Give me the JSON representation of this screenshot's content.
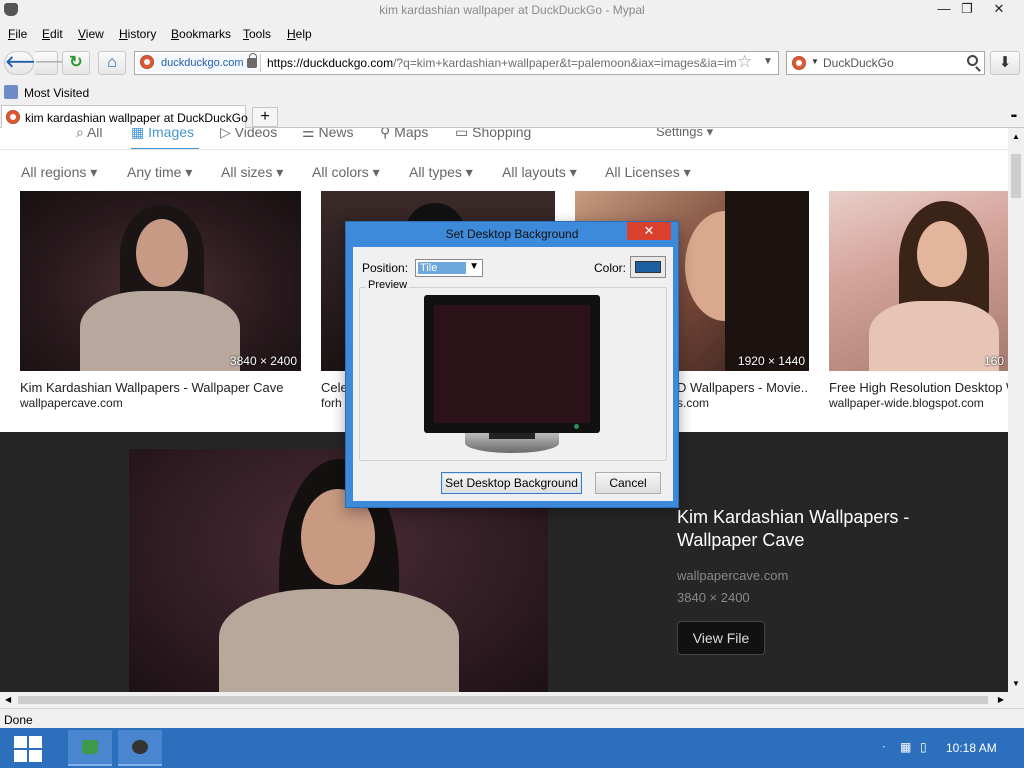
{
  "window": {
    "title": "kim kardashian wallpaper at DuckDuckGo - Mypal",
    "minimize": "—",
    "maximize": "❐",
    "close": "✕"
  },
  "menu": [
    "File",
    "Edit",
    "View",
    "History",
    "Bookmarks",
    "Tools",
    "Help"
  ],
  "nav": {
    "back": "🡐",
    "forward": "🡒",
    "reload": "↻",
    "home": "⌂",
    "domain": "duckduckgo.com",
    "url_host": "https://duckduckgo.com",
    "url_rest": "/?q=kim+kardashian+wallpaper&t=palemoon&iax=images&ia=im",
    "search_placeholder": "DuckDuckGo",
    "download": "⬇"
  },
  "bookmarks": {
    "most_visited": "Most Visited"
  },
  "tabs": {
    "active_title": "kim kardashian wallpaper at DuckDuckGo",
    "new_tab": "+",
    "all_tabs": "▪▪"
  },
  "ddg": {
    "tabs": [
      "All",
      "Images",
      "Videos",
      "News",
      "Maps",
      "Shopping"
    ],
    "settings": "Settings ▾",
    "filters": [
      "All regions ▾",
      "Any time ▾",
      "All sizes ▾",
      "All colors ▾",
      "All types ▾",
      "All layouts ▾",
      "All Licenses ▾"
    ],
    "results": [
      {
        "dim": "3840 × 2400",
        "title": "Kim Kardashian Wallpapers - Wallpaper Cave",
        "source": "wallpapercave.com"
      },
      {
        "dim": "",
        "title": "Cele",
        "source": "forh"
      },
      {
        "dim": "1920 × 1440",
        "title": "D Wallpapers - Movie...",
        "source": "s.com"
      },
      {
        "dim": "160",
        "title": "Free High Resolution Desktop W",
        "source": "wallpaper-wide.blogspot.com"
      }
    ],
    "detail": {
      "title": "Kim Kardashian Wallpapers - Wallpaper Cave",
      "source": "wallpapercave.com",
      "size": "3840 × 2400",
      "view_file": "View File"
    }
  },
  "status": {
    "text": "Done"
  },
  "taskbar": {
    "clock": "10:18 AM"
  },
  "dialog": {
    "title": "Set Desktop Background",
    "close": "✕",
    "position_label": "Position:",
    "position_value": "Tile",
    "color_label": "Color:",
    "preview_label": "Preview",
    "set_button": "Set Desktop Background",
    "cancel_button": "Cancel",
    "color_value": "#1c5f9f"
  }
}
